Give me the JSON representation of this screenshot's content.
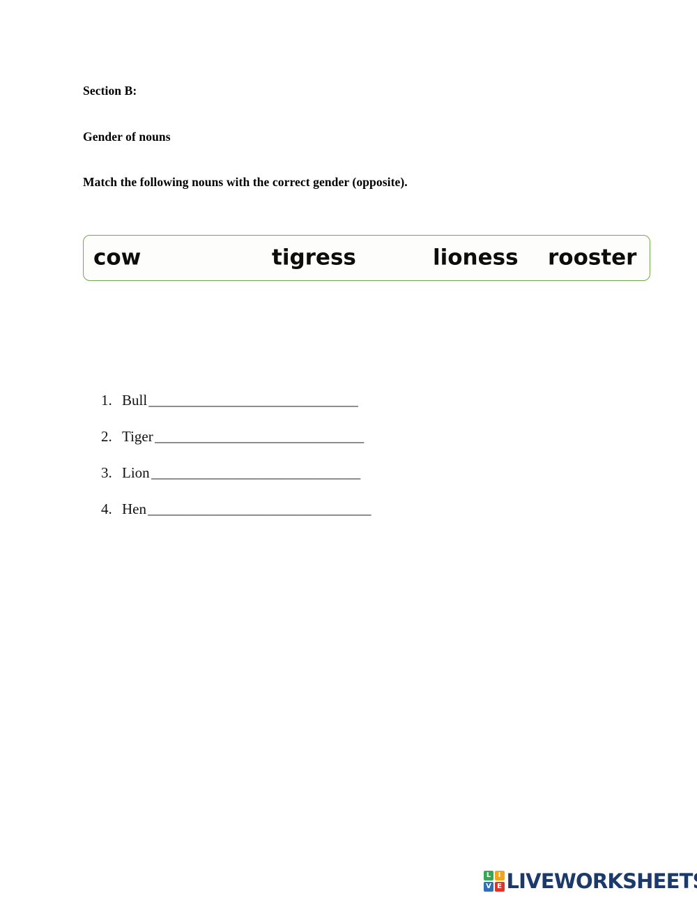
{
  "page": {
    "background_color": "#ffffff",
    "text_color": "#000000"
  },
  "headings": {
    "section": "Section B:",
    "topic": "Gender of nouns",
    "instruction": "Match the following nouns with the correct gender (opposite)."
  },
  "word_bank": {
    "border_color": "#74a84f",
    "background_color": "#fdfdfb",
    "words": [
      {
        "text": "cow"
      },
      {
        "text": "tigress"
      },
      {
        "text": "lioness"
      },
      {
        "text": "rooster"
      }
    ]
  },
  "questions": [
    {
      "number": "1.",
      "word": "Bull",
      "blank": "______________________________"
    },
    {
      "number": "2.",
      "word": "Tiger",
      "blank": "______________________________"
    },
    {
      "number": "3.",
      "word": "Lion",
      "blank": "______________________________"
    },
    {
      "number": "4.",
      "word": "Hen",
      "blank": "________________________________"
    }
  ],
  "footer_logo": {
    "tiles": [
      {
        "letter": "L",
        "color": "#3aa655"
      },
      {
        "letter": "I",
        "color": "#f3a51a"
      },
      {
        "letter": "V",
        "color": "#2f6fb5"
      },
      {
        "letter": "E",
        "color": "#e0342b"
      }
    ],
    "text": "LIVEWORKSHEETS",
    "text_color": "#1b3a6b"
  }
}
